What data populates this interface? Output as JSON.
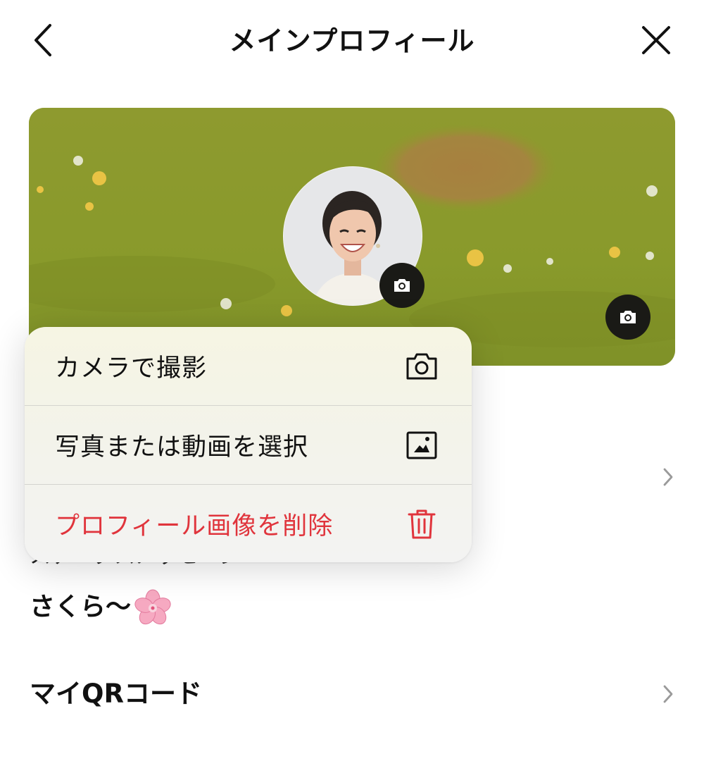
{
  "header": {
    "title": "メインプロフィール",
    "back_icon": "chevron-left-icon",
    "close_icon": "close-icon"
  },
  "profile": {
    "cover_camera_icon": "camera-icon",
    "avatar_camera_icon": "camera-icon"
  },
  "photo_menu": {
    "items": [
      {
        "label": "カメラで撮影",
        "icon": "camera-icon"
      },
      {
        "label": "写真または動画を選択",
        "icon": "photo-icon"
      },
      {
        "label": "プロフィール画像を削除",
        "icon": "trash-icon",
        "color": "#e0343c"
      }
    ]
  },
  "status_message": {
    "label": "ステータスメッセージ",
    "value": "さくら〜",
    "emoji": "sakura-icon"
  },
  "qr": {
    "label": "マイQRコード"
  },
  "colors": {
    "danger": "#e0343c",
    "cover_green": "#8a9b2c",
    "badge_dark": "#1a1a16"
  }
}
